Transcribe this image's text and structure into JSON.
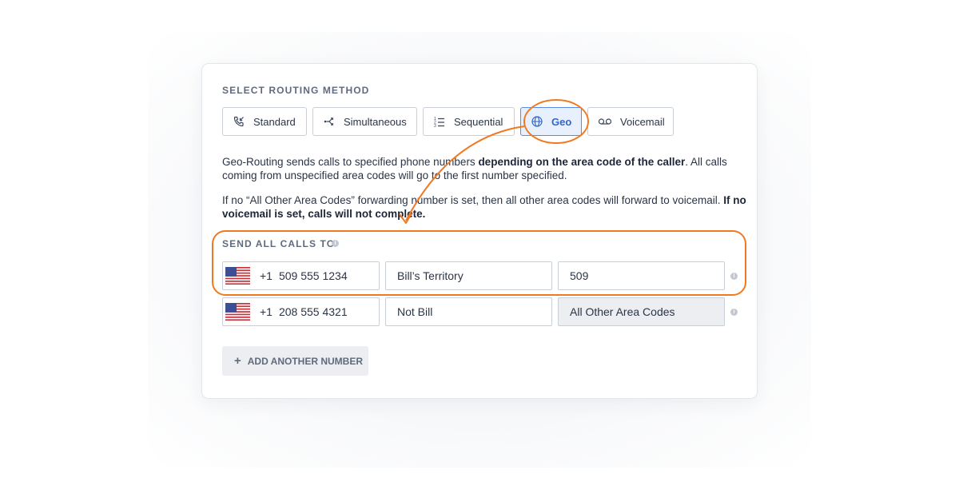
{
  "routing": {
    "section_label": "SELECT ROUTING METHOD",
    "methods": [
      {
        "label": "Standard",
        "icon": "phone-incoming-icon"
      },
      {
        "label": "Simultaneous",
        "icon": "split-arrows-icon"
      },
      {
        "label": "Sequential",
        "icon": "numbered-list-icon"
      },
      {
        "label": "Geo",
        "icon": "globe-icon",
        "selected": true
      },
      {
        "label": "Voicemail",
        "icon": "voicemail-icon"
      }
    ]
  },
  "description": {
    "p1_text": "Geo-Routing sends calls to specified phone numbers ",
    "p1_bold": "depending on the area code of the caller",
    "p1_rest": ". All calls coming from unspecified area codes will go to the first number specified.",
    "p2_text": "If no “All Other Area Codes” forwarding number is set, then all other area codes will forward to voicemail. ",
    "p2_bold": "If no voicemail is set, calls will not complete."
  },
  "send_all": {
    "section_label": "SEND ALL CALLS TO",
    "rows": [
      {
        "country_code": "+1",
        "phone": "509 555 1234",
        "name": "Bill’s Territory",
        "area_code": "509"
      },
      {
        "country_code": "+1",
        "phone": "208 555 4321",
        "name": "Not Bill",
        "area_code": "All Other Area Codes"
      }
    ],
    "add_label": "ADD ANOTHER NUMBER"
  },
  "colors": {
    "accent": "#2f66cf",
    "selected_bg": "#e9f0fd",
    "annotation": "#ef7a22"
  }
}
